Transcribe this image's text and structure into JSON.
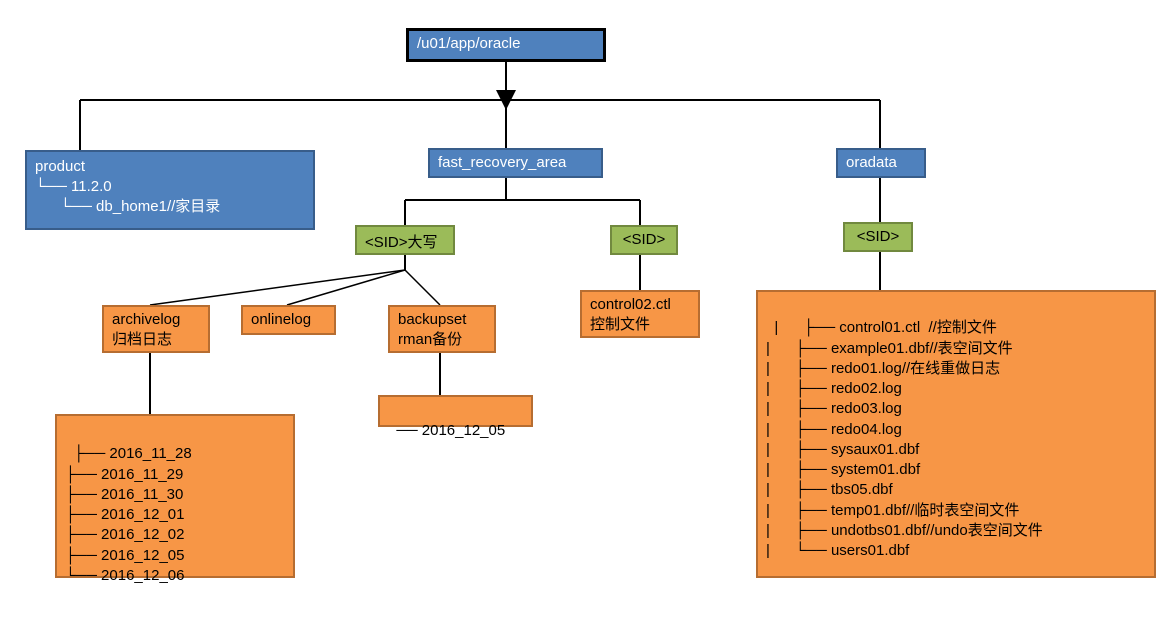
{
  "root": {
    "path": "/u01/app/oracle"
  },
  "product": {
    "title": "product",
    "line1": "└── 11.2.0",
    "line2": "      └── db_home1//家目录"
  },
  "fra": {
    "title": "fast_recovery_area",
    "sid_upper": "<SID>大写",
    "sid_plain": "<SID>",
    "archivelog": {
      "title": "archivelog",
      "subtitle": " 归档日志",
      "dates": "├── 2016_11_28\n├── 2016_11_29\n├── 2016_11_30\n├── 2016_12_01\n├── 2016_12_02\n├── 2016_12_05\n└── 2016_12_06"
    },
    "onlinelog": {
      "title": "onlinelog"
    },
    "backupset": {
      "title": "backupset",
      "subtitle": " rman备份",
      "dates": "── 2016_12_05"
    },
    "control02": {
      "title": "control02.ctl",
      "subtitle": "控制文件"
    }
  },
  "oradata": {
    "title": "oradata",
    "sid": "<SID>",
    "files": "|      ├── control01.ctl  //控制文件\n|      ├── example01.dbf//表空间文件\n|      ├── redo01.log//在线重做日志\n|      ├── redo02.log\n|      ├── redo03.log\n|      ├── redo04.log\n|      ├── sysaux01.dbf\n|      ├── system01.dbf\n|      ├── tbs05.dbf\n|      ├── temp01.dbf//临时表空间文件\n|      ├── undotbs01.dbf//undo表空间文件\n|      └── users01.dbf"
  }
}
